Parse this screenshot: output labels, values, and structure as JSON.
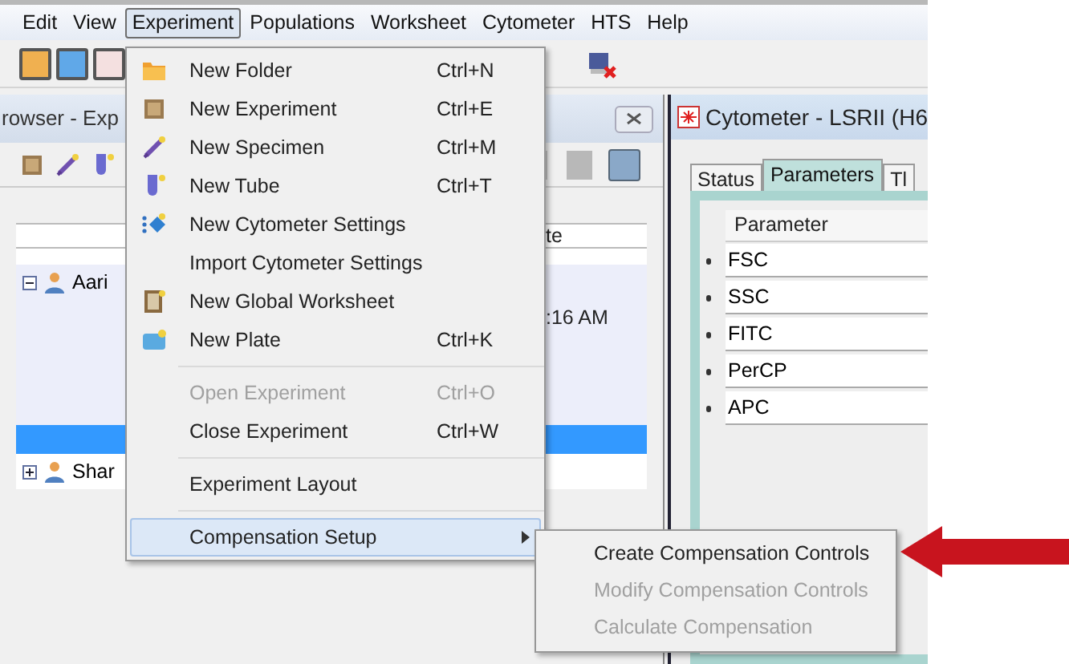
{
  "menu_bar": [
    {
      "label": "Edit",
      "selected": false
    },
    {
      "label": "View",
      "selected": false
    },
    {
      "label": "Experiment",
      "selected": true
    },
    {
      "label": "Populations",
      "selected": false
    },
    {
      "label": "Worksheet",
      "selected": false
    },
    {
      "label": "Cytometer",
      "selected": false
    },
    {
      "label": "HTS",
      "selected": false
    },
    {
      "label": "Help",
      "selected": false
    }
  ],
  "browser": {
    "title": "rowser - Exp",
    "column_header": "te",
    "time": ":16 AM",
    "tree": [
      {
        "label": "Aari",
        "expanded": true,
        "selected": false
      },
      {
        "label": "Shar",
        "expanded": false,
        "selected": false
      }
    ]
  },
  "cytometer": {
    "title": "Cytometer - LSRII (H6",
    "tabs": [
      {
        "label": "Status",
        "selected": false
      },
      {
        "label": "Parameters",
        "selected": true
      },
      {
        "label": "Tl",
        "selected": false
      }
    ],
    "column_header": "Parameter",
    "parameters": [
      "FSC",
      "SSC",
      "FITC",
      "PerCP",
      "APC"
    ]
  },
  "experiment_menu": {
    "groups": [
      [
        {
          "label": "New Folder",
          "shortcut": "Ctrl+N",
          "kind": "folder",
          "disabled": false,
          "selected": false
        },
        {
          "label": "New Experiment",
          "shortcut": "Ctrl+E",
          "kind": "experiment",
          "disabled": false,
          "selected": false
        },
        {
          "label": "New Specimen",
          "shortcut": "Ctrl+M",
          "kind": "specimen",
          "disabled": false,
          "selected": false
        },
        {
          "label": "New Tube",
          "shortcut": "Ctrl+T",
          "kind": "tube",
          "disabled": false,
          "selected": false
        },
        {
          "label": "New Cytometer Settings",
          "kind": "settings",
          "disabled": false,
          "selected": false
        },
        {
          "label": "Import Cytometer Settings",
          "kind": "plain",
          "disabled": false,
          "selected": false
        },
        {
          "label": "New Global Worksheet",
          "kind": "worksheet",
          "disabled": false,
          "selected": false
        },
        {
          "label": "New Plate",
          "shortcut": "Ctrl+K",
          "kind": "plate",
          "disabled": false,
          "selected": false
        }
      ],
      [
        {
          "label": "Open Experiment",
          "shortcut": "Ctrl+O",
          "kind": "plain",
          "disabled": true,
          "selected": false
        },
        {
          "label": "Close Experiment",
          "shortcut": "Ctrl+W",
          "kind": "plain",
          "disabled": false,
          "selected": false
        }
      ],
      [
        {
          "label": "Experiment Layout",
          "kind": "plain",
          "disabled": false,
          "selected": false
        }
      ],
      [
        {
          "label": "Compensation Setup",
          "kind": "submenu",
          "disabled": false,
          "selected": true
        }
      ]
    ]
  },
  "compensation_submenu": [
    {
      "label": "Create Compensation Controls",
      "disabled": false,
      "selected": false
    },
    {
      "label": "Modify Compensation Controls",
      "disabled": true,
      "selected": false
    },
    {
      "label": "Calculate Compensation",
      "disabled": true,
      "selected": false
    }
  ]
}
